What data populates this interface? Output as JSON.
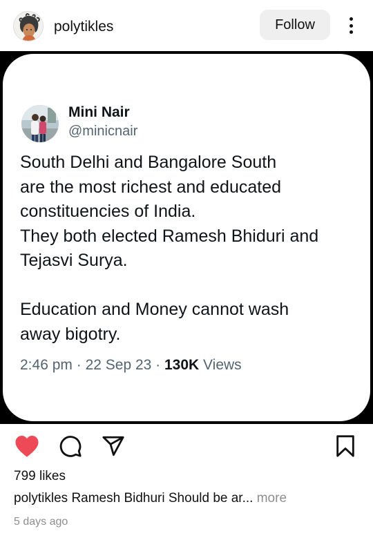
{
  "header": {
    "username": "polytikles",
    "follow_label": "Follow",
    "avatar_icon": "profile-illustration-avatar",
    "more_icon": "vertical-dots-icon"
  },
  "tweet": {
    "name": "Mini Nair",
    "handle": "@minicnair",
    "text": "South Delhi and Bangalore South\nare the most richest and educated\nconstituencies of India.\nThey both elected Ramesh Bhiduri and\nTejasvi Surya.\n\nEducation and Money cannot wash\naway bigotry.",
    "time": "2:46 pm",
    "date": "22 Sep 23",
    "views_count": "130K",
    "views_label": "Views"
  },
  "actions": {
    "like_icon": "heart-filled-icon",
    "comment_icon": "comment-icon",
    "share_icon": "send-icon",
    "save_icon": "bookmark-icon",
    "like_color": "#ed4956"
  },
  "likes": "799 likes",
  "caption": {
    "username": "polytikles",
    "text": "Ramesh Bidhuri Should be ar...",
    "more_label": "more"
  },
  "posted": "5 days ago"
}
